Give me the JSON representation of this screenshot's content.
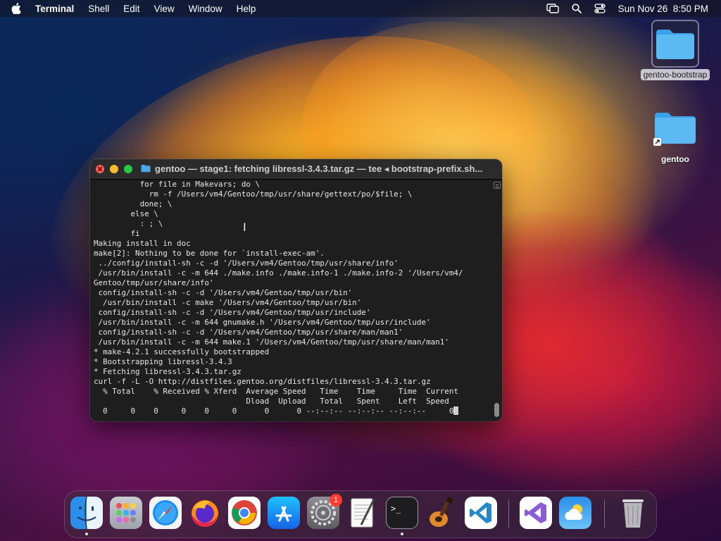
{
  "menubar": {
    "app_name": "Terminal",
    "items": [
      "Shell",
      "Edit",
      "View",
      "Window",
      "Help"
    ],
    "datetime": "Sun Nov 26  8:50 PM"
  },
  "desktop": {
    "icons": [
      {
        "label": "gentoo-bootstrap",
        "selected": true
      },
      {
        "label": "gentoo",
        "selected": false
      }
    ]
  },
  "terminal": {
    "title": "gentoo — stage1: fetching libressl-3.4.3.tar.gz — tee ◂ bootstrap-prefix.sh...",
    "lines": [
      "          for file in Makevars; do \\",
      "            rm -f /Users/vm4/Gentoo/tmp/usr/share/gettext/po/$file; \\",
      "          done; \\",
      "        else \\",
      "          : ; \\",
      "        fi",
      "Making install in doc",
      "make[2]: Nothing to be done for `install-exec-am'.",
      " ../config/install-sh -c -d '/Users/vm4/Gentoo/tmp/usr/share/info'",
      " /usr/bin/install -c -m 644 ./make.info ./make.info-1 ./make.info-2 '/Users/vm4/",
      "Gentoo/tmp/usr/share/info'",
      " config/install-sh -c -d '/Users/vm4/Gentoo/tmp/usr/bin'",
      "  /usr/bin/install -c make '/Users/vm4/Gentoo/tmp/usr/bin'",
      " config/install-sh -c -d '/Users/vm4/Gentoo/tmp/usr/include'",
      " /usr/bin/install -c -m 644 gnumake.h '/Users/vm4/Gentoo/tmp/usr/include'",
      " config/install-sh -c -d '/Users/vm4/Gentoo/tmp/usr/share/man/man1'",
      " /usr/bin/install -c -m 644 make.1 '/Users/vm4/Gentoo/tmp/usr/share/man/man1'",
      "* make-4.2.1 successfully bootstrapped",
      "* Bootstrapping libressl-3.4.3",
      "* Fetching libressl-3.4.3.tar.gz",
      "curl -f -L -O http://distfiles.gentoo.org/distfiles/libressl-3.4.3.tar.gz",
      "  % Total    % Received % Xferd  Average Speed   Time    Time     Time  Current",
      "                                 Dload  Upload   Total   Spent    Left  Speed",
      "  0     0    0     0    0     0      0      0 --:--:-- --:--:-- --:--:--     0"
    ]
  },
  "dock": {
    "apps": [
      {
        "name": "Finder",
        "running": true
      },
      {
        "name": "Launchpad",
        "running": false
      },
      {
        "name": "Safari",
        "running": false
      },
      {
        "name": "Firefox",
        "running": false
      },
      {
        "name": "Google Chrome",
        "running": false
      },
      {
        "name": "App Store",
        "running": false
      },
      {
        "name": "System Preferences",
        "running": false,
        "badge": "1"
      },
      {
        "name": "TextEdit",
        "running": false
      },
      {
        "name": "Terminal",
        "running": true
      },
      {
        "name": "GarageBand",
        "running": false
      },
      {
        "name": "Visual Studio Code",
        "running": false
      },
      {
        "name": "Visual Studio",
        "running": false
      },
      {
        "name": "Weather",
        "running": false
      },
      {
        "name": "Trash",
        "running": false
      }
    ]
  }
}
